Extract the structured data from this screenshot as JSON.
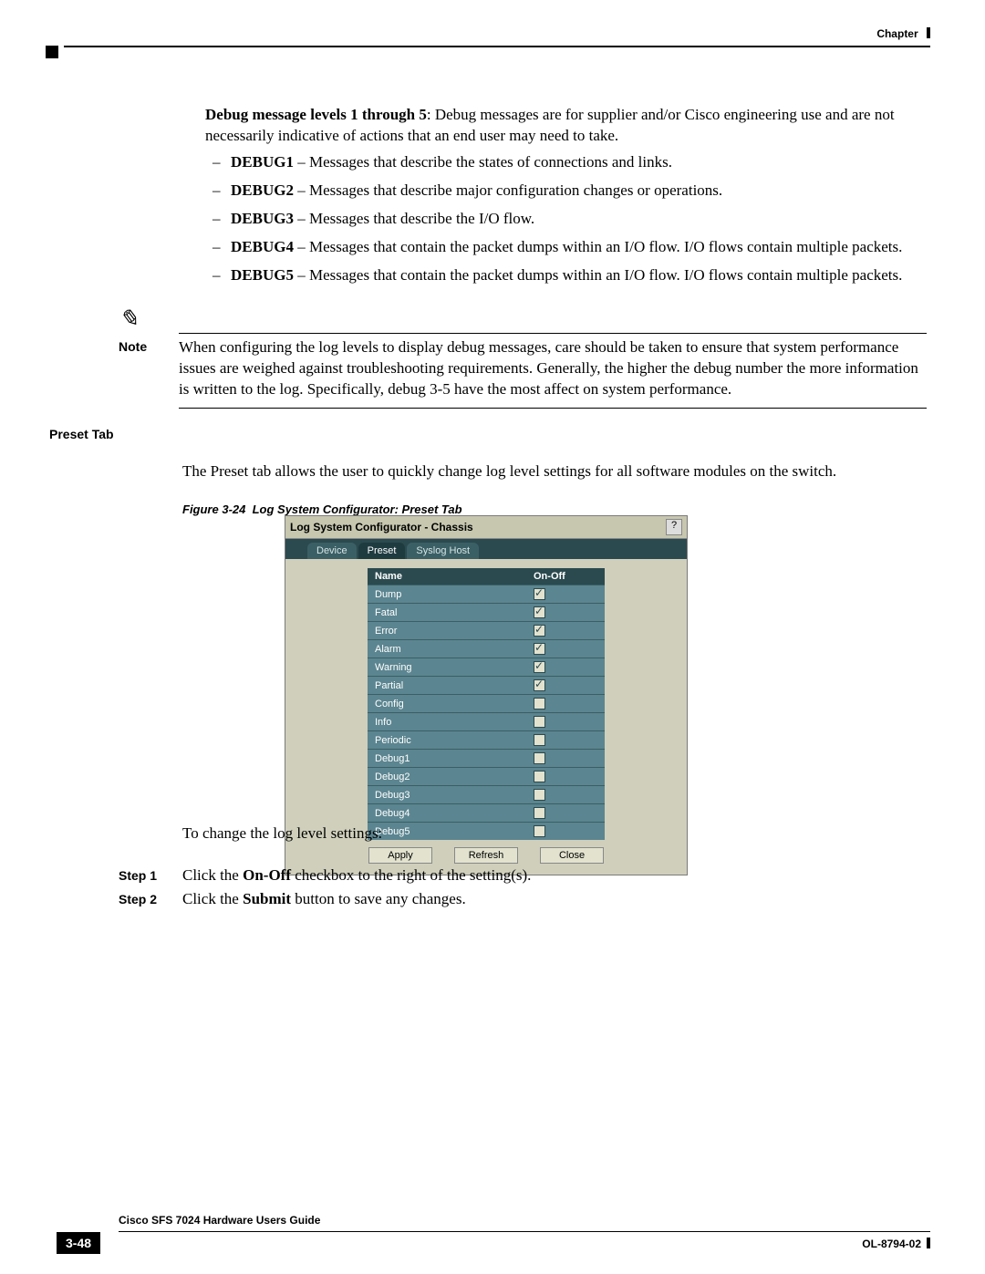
{
  "header": {
    "chapter": "Chapter"
  },
  "intro": {
    "lead_bold": "Debug message levels 1 through 5",
    "lead_rest": ": Debug messages are for supplier and/or Cisco engineering use and are not necessarily indicative of actions that an end user may need to take."
  },
  "debug_levels": [
    {
      "name": "DEBUG1",
      "desc": " – Messages that describe the states of connections and links."
    },
    {
      "name": "DEBUG2",
      "desc": " – Messages that describe major configuration changes or operations."
    },
    {
      "name": "DEBUG3",
      "desc": " – Messages that describe the I/O flow."
    },
    {
      "name": "DEBUG4",
      "desc": " – Messages that contain the packet dumps within an I/O flow. I/O flows contain multiple packets."
    },
    {
      "name": "DEBUG5",
      "desc": " – Messages that contain the packet dumps within an I/O flow. I/O flows contain multiple packets."
    }
  ],
  "note": {
    "label": "Note",
    "text": "When configuring the log levels to display debug messages, care should be taken to ensure that system performance issues are weighed against troubleshooting requirements. Generally, the higher the debug number the more information is written to the log. Specifically, debug 3-5 have the most affect on system performance."
  },
  "section": {
    "heading": "Preset Tab",
    "body": "The Preset tab allows the user to quickly change log level settings for all software modules on the switch."
  },
  "figure": {
    "number": "Figure 3-24",
    "title": "Log System Configurator: Preset Tab"
  },
  "screenshot": {
    "window_title": "Log System Configurator - Chassis",
    "help": "?",
    "tabs": {
      "device": "Device",
      "preset": "Preset",
      "syslog": "Syslog Host"
    },
    "columns": {
      "name": "Name",
      "onoff": "On-Off"
    },
    "rows": [
      {
        "name": "Dump",
        "checked": true
      },
      {
        "name": "Fatal",
        "checked": true
      },
      {
        "name": "Error",
        "checked": true
      },
      {
        "name": "Alarm",
        "checked": true
      },
      {
        "name": "Warning",
        "checked": true
      },
      {
        "name": "Partial",
        "checked": true
      },
      {
        "name": "Config",
        "checked": false
      },
      {
        "name": "Info",
        "checked": false
      },
      {
        "name": "Periodic",
        "checked": false
      },
      {
        "name": "Debug1",
        "checked": false
      },
      {
        "name": "Debug2",
        "checked": false
      },
      {
        "name": "Debug3",
        "checked": false
      },
      {
        "name": "Debug4",
        "checked": false
      },
      {
        "name": "Debug5",
        "checked": false
      }
    ],
    "buttons": {
      "apply": "Apply",
      "refresh": "Refresh",
      "close": "Close"
    }
  },
  "procedure": {
    "intro": "To change the log level settings:",
    "step1": {
      "label": "Step 1",
      "pre": "Click the ",
      "b": "On-Off",
      "post": " checkbox to the right of the setting(s)."
    },
    "step2": {
      "label": "Step 2",
      "pre": "Click the ",
      "b": "Submit",
      "post": " button to save any changes."
    }
  },
  "footer": {
    "book": "Cisco SFS 7024 Hardware Users Guide",
    "page": "3-48",
    "doc": "OL-8794-02"
  }
}
